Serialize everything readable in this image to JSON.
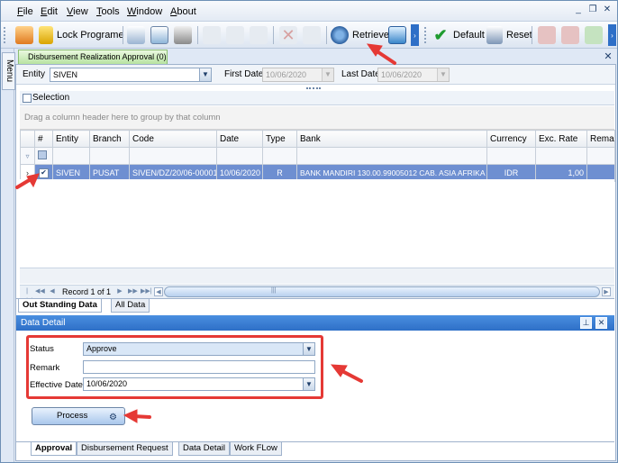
{
  "menu": {
    "items": [
      "File",
      "Edit",
      "View",
      "Tools",
      "Window",
      "About"
    ],
    "mnemonics": [
      "F",
      "E",
      "V",
      "T",
      "W",
      "A"
    ],
    "rests": [
      "ile",
      "dit",
      "iew",
      "ools",
      "indow",
      "bout"
    ]
  },
  "toolbar": {
    "lock_label": "Lock Programe",
    "retrieve_label": "Retrieve",
    "default_label": "Default",
    "reset_label": "Reset"
  },
  "sidebar": {
    "menu_label": "Menu"
  },
  "doc_tab": {
    "label": "Disbursement Realization Approval (0)"
  },
  "filter": {
    "entity_label": "Entity",
    "entity_value": "SIVEN",
    "first_date_label": "First Date",
    "first_date_value": "10/06/2020",
    "last_date_label": "Last Date",
    "last_date_value": "10/06/2020"
  },
  "selection": {
    "label": "Selection"
  },
  "grid": {
    "group_hint": "Drag a column header here to group by that column",
    "columns": [
      "#",
      "Entity",
      "Branch",
      "Code",
      "Date",
      "Type",
      "Bank",
      "Currency",
      "Exc. Rate",
      "Rema"
    ],
    "rows": [
      {
        "checked": true,
        "entity": "SIVEN",
        "branch": "PUSAT",
        "code": "SIVEN/DZ/20/06-00001",
        "date": "10/06/2020",
        "type": "R",
        "bank": "BANK MANDIRI 130.00.99005012 CAB. ASIA AFRIKA",
        "currency": "IDR",
        "rate": "1,00",
        "remark": ""
      }
    ],
    "record_text": "Record 1 of 1"
  },
  "grid_tabs": [
    "Out Standing Data",
    "All Data"
  ],
  "data_detail": {
    "title": "Data Detail",
    "status_label": "Status",
    "status_value": "Approve",
    "remark_label": "Remark",
    "remark_value": "",
    "effective_label": "Effective Date",
    "effective_value": "10/06/2020",
    "process_label": "Process"
  },
  "bottom_tabs": [
    "Approval",
    "Disbursement Request",
    "Data Detail",
    "Work FLow"
  ],
  "colors": {
    "accent": "#2e6fc7",
    "selected_row": "#6e8fd1",
    "annotation": "#e53935",
    "tab_green": "#b7e3a1"
  }
}
